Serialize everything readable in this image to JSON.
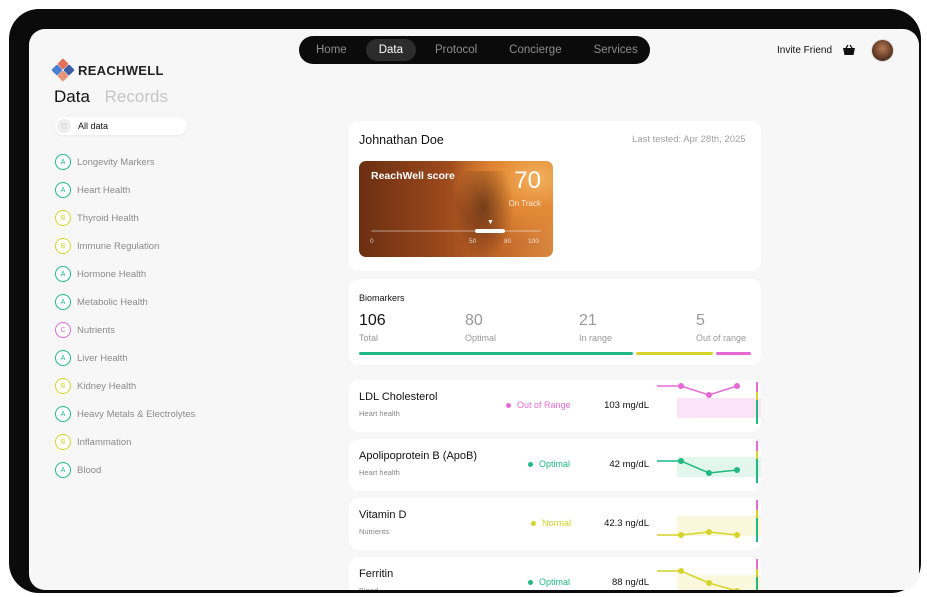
{
  "brand": {
    "name": "REACHWELL"
  },
  "nav": {
    "items": [
      {
        "label": "Home",
        "active": false
      },
      {
        "label": "Data",
        "active": true
      },
      {
        "label": "Protocol",
        "active": false
      },
      {
        "label": "Concierge",
        "active": false
      },
      {
        "label": "Services",
        "active": false
      }
    ]
  },
  "header": {
    "invite_label": "Invite Friend",
    "basket_icon": "basket-icon",
    "avatar_icon": "avatar"
  },
  "tabs": {
    "data": "Data",
    "records": "Records"
  },
  "sidebar": {
    "all_data": "All data",
    "items": [
      {
        "badge": "A",
        "label": "Longevity Markers"
      },
      {
        "badge": "A",
        "label": "Heart Health"
      },
      {
        "badge": "B",
        "label": "Thyroid Health"
      },
      {
        "badge": "B",
        "label": "Immune Regulation"
      },
      {
        "badge": "A",
        "label": "Hormone Health"
      },
      {
        "badge": "A",
        "label": "Metabolic Health"
      },
      {
        "badge": "C",
        "label": "Nutrients"
      },
      {
        "badge": "A",
        "label": "Liver Health"
      },
      {
        "badge": "B",
        "label": "Kidney Health"
      },
      {
        "badge": "A",
        "label": "Heavy Metals & Electrolytes"
      },
      {
        "badge": "B",
        "label": "Inflammation"
      },
      {
        "badge": "A",
        "label": "Blood"
      }
    ],
    "badge_colors": {
      "A": "#1fb981",
      "B": "#d6d42a",
      "C": "#e56ad6"
    }
  },
  "patient": {
    "name": "Johnathan Doe",
    "last_tested": "Last tested: Apr 28th, 2025"
  },
  "score": {
    "title": "ReachWell score",
    "value": "70",
    "status": "On Track",
    "ticks": [
      "0",
      "50",
      "80",
      "100"
    ],
    "level": 70
  },
  "biomarkers": {
    "title": "Biomarkers",
    "total": {
      "value": "106",
      "label": "Total"
    },
    "optimal": {
      "value": "80",
      "label": "Optimal"
    },
    "in_range": {
      "value": "21",
      "label": "In range"
    },
    "out_of_range": {
      "value": "5",
      "label": "Out of range"
    },
    "bar_colors": {
      "optimal": "#1fb981",
      "in_range": "#d6d42a",
      "out_of_range": "#e56ad6"
    }
  },
  "rows": [
    {
      "name": "LDL Cholesterol",
      "category": "Heart health",
      "status": "Out of Range",
      "status_color": "#e56ad6",
      "value": "103 mg/dL"
    },
    {
      "name": "Apolipoprotein B (ApoB)",
      "category": "Heart health",
      "status": "Optimal",
      "status_color": "#1fb981",
      "value": "42 mg/dL"
    },
    {
      "name": "Vitamin D",
      "category": "Nutrients",
      "status": "Normal",
      "status_color": "#d6d42a",
      "value": "42.3 ng/dL"
    },
    {
      "name": "Ferritin",
      "category": "Blood",
      "status": "Optimal",
      "status_color": "#1fb981",
      "value": "88 ng/dL"
    }
  ]
}
